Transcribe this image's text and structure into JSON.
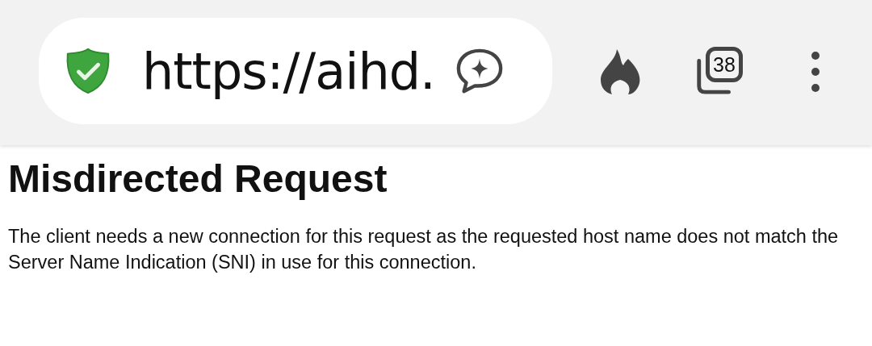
{
  "toolbar": {
    "url": "https://aihd.",
    "tab_count": "38"
  },
  "page": {
    "heading": "Misdirected Request",
    "paragraph": "The client needs a new connection for this request as the requested host name does not match the Server Name Indication (SNI) in use for this connection."
  }
}
